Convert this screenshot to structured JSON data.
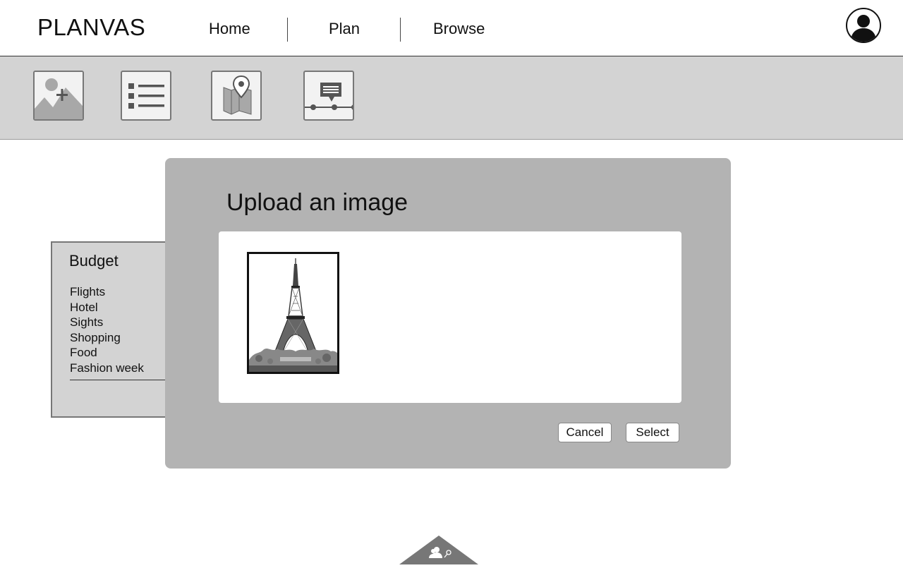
{
  "app": {
    "logo": "PLANVAS"
  },
  "nav": {
    "items": [
      "Home",
      "Plan",
      "Browse"
    ]
  },
  "icons": {
    "avatar": "user-avatar-icon",
    "toolbar": [
      "add-image-icon",
      "list-icon",
      "map-pin-icon",
      "timeline-comment-icon"
    ],
    "bottom_tab": "people-search-icon"
  },
  "budget": {
    "title": "Budget",
    "items": [
      "Flights",
      "Hotel",
      "Sights",
      "Shopping",
      "Food",
      "Fashion week"
    ]
  },
  "modal": {
    "title": "Upload an image",
    "cancel_label": "Cancel",
    "select_label": "Select"
  },
  "colors": {
    "toolbar_bg": "#d3d3d3",
    "modal_bg": "#b3b3b3",
    "panel_border": "#777777"
  }
}
